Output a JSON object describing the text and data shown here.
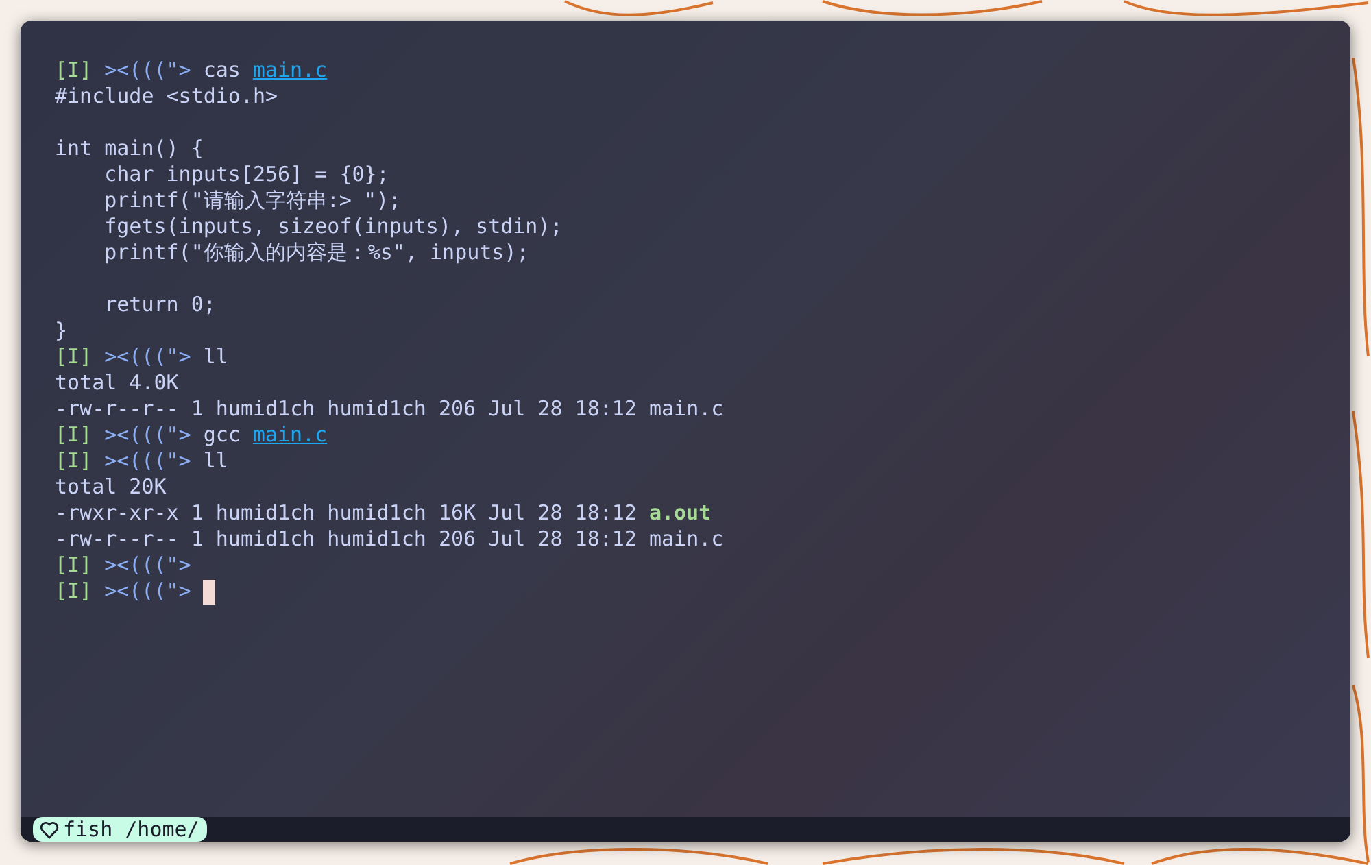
{
  "terminal": {
    "lines": [
      {
        "kind": "text",
        "segments": [
          {
            "kind": "mode",
            "text": "[I]"
          },
          {
            "kind": "prompt",
            "text": "><(((\">"
          },
          {
            "kind": "command",
            "text": "cas"
          },
          {
            "kind": "link",
            "text": "main.c"
          }
        ]
      },
      {
        "kind": "text",
        "segments": [
          {
            "kind": "plain",
            "text": "#include <stdio.h>"
          }
        ]
      },
      {
        "kind": "blank"
      },
      {
        "kind": "text",
        "segments": [
          {
            "kind": "plain",
            "text": "int main() {"
          }
        ]
      },
      {
        "kind": "text",
        "segments": [
          {
            "kind": "plain",
            "text": "    char inputs[256] = {0};"
          }
        ]
      },
      {
        "kind": "text",
        "segments": [
          {
            "kind": "plain",
            "text": "    printf(\"请输入字符串:> \");"
          }
        ]
      },
      {
        "kind": "text",
        "segments": [
          {
            "kind": "plain",
            "text": "    fgets(inputs, sizeof(inputs), stdin);"
          }
        ]
      },
      {
        "kind": "text",
        "segments": [
          {
            "kind": "plain",
            "text": "    printf(\"你输入的内容是：%s\", inputs);"
          }
        ]
      },
      {
        "kind": "blank"
      },
      {
        "kind": "text",
        "segments": [
          {
            "kind": "plain",
            "text": "    return 0;"
          }
        ]
      },
      {
        "kind": "text",
        "segments": [
          {
            "kind": "plain",
            "text": "}"
          }
        ]
      },
      {
        "kind": "text",
        "segments": [
          {
            "kind": "mode",
            "text": "[I]"
          },
          {
            "kind": "prompt",
            "text": "><(((\">"
          },
          {
            "kind": "command",
            "text": "ll"
          }
        ]
      },
      {
        "kind": "text",
        "segments": [
          {
            "kind": "plain",
            "text": "total 4.0K"
          }
        ]
      },
      {
        "kind": "text",
        "segments": [
          {
            "kind": "plain",
            "text": "-rw-r--r-- 1 humid1ch humid1ch 206 Jul 28 18:12 main.c"
          }
        ]
      },
      {
        "kind": "text",
        "segments": [
          {
            "kind": "mode",
            "text": "[I]"
          },
          {
            "kind": "prompt",
            "text": "><(((\">"
          },
          {
            "kind": "command",
            "text": "gcc"
          },
          {
            "kind": "link",
            "text": "main.c"
          }
        ]
      },
      {
        "kind": "text",
        "segments": [
          {
            "kind": "mode",
            "text": "[I]"
          },
          {
            "kind": "prompt",
            "text": "><(((\">"
          },
          {
            "kind": "command",
            "text": "ll"
          }
        ]
      },
      {
        "kind": "text",
        "segments": [
          {
            "kind": "plain",
            "text": "total 20K"
          }
        ]
      },
      {
        "kind": "text",
        "segments": [
          {
            "kind": "plain",
            "text": "-rwxr-xr-x 1 humid1ch humid1ch 16K Jul 28 18:12"
          },
          {
            "kind": "executable",
            "text": "a.out"
          }
        ]
      },
      {
        "kind": "text",
        "segments": [
          {
            "kind": "plain",
            "text": "-rw-r--r-- 1 humid1ch humid1ch 206 Jul 28 18:12 main.c"
          }
        ]
      },
      {
        "kind": "text",
        "segments": [
          {
            "kind": "mode",
            "text": "[I]"
          },
          {
            "kind": "prompt",
            "text": "><(((\">"
          }
        ]
      },
      {
        "kind": "text",
        "cursor": true,
        "segments": [
          {
            "kind": "mode",
            "text": "[I]"
          },
          {
            "kind": "prompt",
            "text": "><(((\">"
          }
        ]
      }
    ]
  },
  "status_bar": {
    "label": "fish /home/"
  }
}
